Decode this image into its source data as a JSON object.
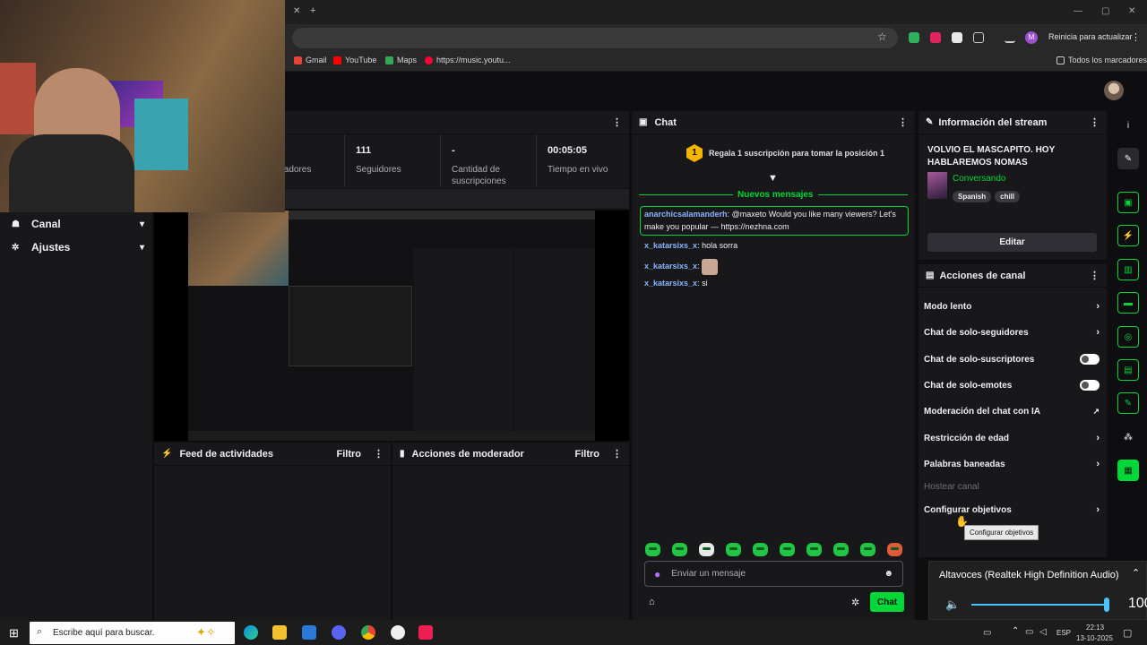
{
  "browser": {
    "bookmarks": [
      "Gmail",
      "YouTube",
      "Maps",
      "https://music.youtu..."
    ],
    "all_bookmarks": "Todos los marcadores",
    "relaunch": "Reinicia para actualizar",
    "profile_initial": "M"
  },
  "sidebar": {
    "items": [
      {
        "label": "Canal",
        "icon": "people-icon"
      },
      {
        "label": "Ajustes",
        "icon": "gear-icon"
      }
    ]
  },
  "stats": {
    "viewers_label_partial": "tadores",
    "followers_value": "111",
    "followers_label": "Seguidores",
    "subs_value": "-",
    "subs_label": "Cantidad de suscripciones",
    "uptime_value": "00:05:05",
    "uptime_label": "Tiempo en vivo"
  },
  "panels": {
    "activity_feed": "Feed de actividades",
    "mod_actions": "Acciones de moderador",
    "filter": "Filtro"
  },
  "chat": {
    "title": "Chat",
    "gift_badge": "1",
    "gift_text": "Regala 1 suscripción para tomar la posición 1",
    "new_messages": "Nuevos mensajes",
    "messages": [
      {
        "user": "anarchicsalamanderh",
        "text": "@maxeto Would you like many viewers? Let's make you popular — https://nezhna.com",
        "highlight": true
      },
      {
        "user": "x_katarsixs_x",
        "text": "hola sorra"
      },
      {
        "user": "x_katarsixs_x",
        "text": ""
      },
      {
        "user": "x_katarsixs_x",
        "text": "si"
      }
    ],
    "input_placeholder": "Enviar un mensaje",
    "send_label": "Chat"
  },
  "stream_info": {
    "header": "Información del stream",
    "title": "VOLVIO EL MASCAPITO. HOY HABLAREMOS NOMAS",
    "category": "Conversando",
    "tags": [
      "Spanish",
      "chill"
    ],
    "edit_label": "Editar"
  },
  "channel_actions": {
    "header": "Acciones de canal",
    "rows": [
      {
        "label": "Modo lento",
        "control": "chevron"
      },
      {
        "label": "Chat de solo-seguidores",
        "control": "chevron"
      },
      {
        "label": "Chat de solo-suscriptores",
        "control": "toggle"
      },
      {
        "label": "Chat de solo-emotes",
        "control": "toggle"
      },
      {
        "label": "Moderación del chat con IA",
        "control": "external"
      },
      {
        "label": "Restricción de edad",
        "control": "chevron"
      },
      {
        "label": "Palabras baneadas",
        "control": "chevron"
      },
      {
        "label": "Hostear canal",
        "control": "none",
        "disabled": true
      },
      {
        "label": "Configurar objetivos",
        "control": "chevron"
      }
    ],
    "tooltip": "Configurar objetivos"
  },
  "volume": {
    "device": "Altavoces (Realtek High Definition Audio)",
    "level": "100",
    "level_fraction": 1.0
  },
  "taskbar": {
    "search_placeholder": "Escribe aquí para buscar.",
    "lang": "ESP",
    "time": "22:13",
    "date": "13-10-2025"
  },
  "colors": {
    "accent_green": "#00d837",
    "bg": "#0e0e10",
    "panel": "#18181b"
  }
}
